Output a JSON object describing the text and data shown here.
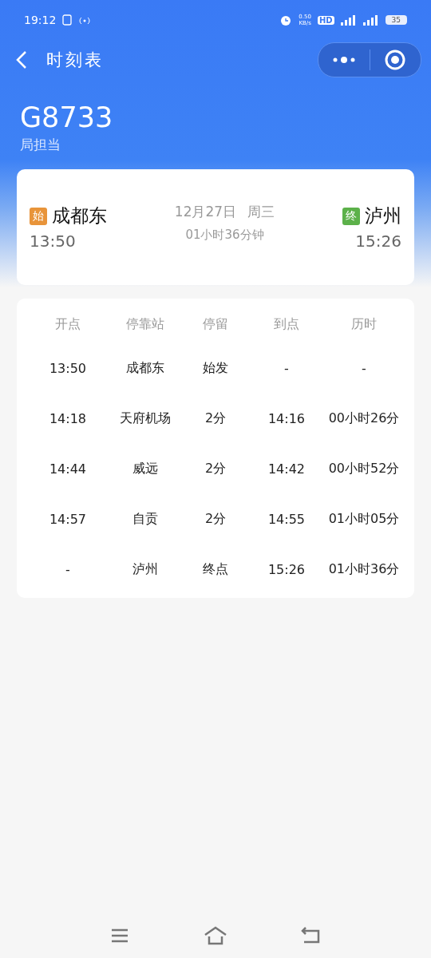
{
  "status_bar": {
    "time": "19:12",
    "speed": "0.50",
    "speed_unit": "KB/s",
    "hd": "HD",
    "battery": "35"
  },
  "nav": {
    "title": "时刻表"
  },
  "train": {
    "number": "G8733",
    "operator": "局担当"
  },
  "journey": {
    "from": {
      "badge": "始",
      "station": "成都东",
      "time": "13:50",
      "color": "#e8943a"
    },
    "to": {
      "badge": "终",
      "station": "泸州",
      "time": "15:26",
      "color": "#5cb14a"
    },
    "date": "12月27日",
    "weekday": "周三",
    "duration": "01小时36分钟"
  },
  "table": {
    "columns": [
      "开点",
      "停靠站",
      "停留",
      "到点",
      "历时"
    ],
    "rows": [
      [
        "13:50",
        "成都东",
        "始发",
        "-",
        "-"
      ],
      [
        "14:18",
        "天府机场",
        "2分",
        "14:16",
        "00小时26分"
      ],
      [
        "14:44",
        "威远",
        "2分",
        "14:42",
        "00小时52分"
      ],
      [
        "14:57",
        "自贡",
        "2分",
        "14:55",
        "01小时05分"
      ],
      [
        "-",
        "泸州",
        "终点",
        "15:26",
        "01小时36分"
      ]
    ]
  }
}
